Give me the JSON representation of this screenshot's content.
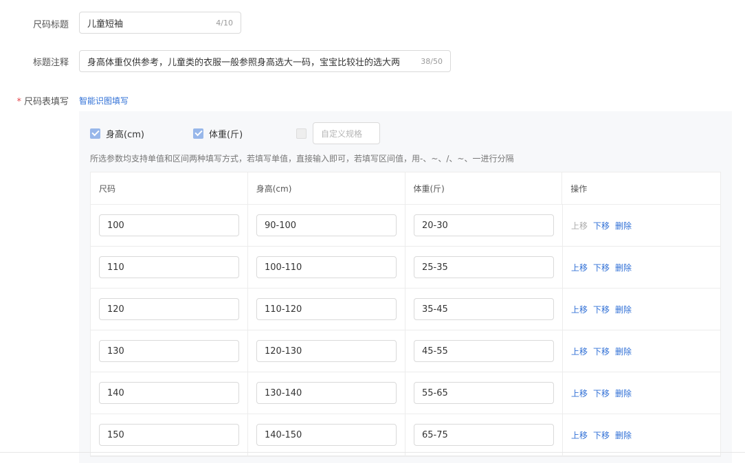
{
  "form": {
    "size_title": {
      "label": "尺码标题",
      "value": "儿童短袖",
      "count": "4/10"
    },
    "title_note": {
      "label": "标题注释",
      "value": "身高体重仅供参考，儿童类的衣服一般参照身高选大一码，宝宝比较壮的选大两",
      "count": "38/50"
    },
    "size_table": {
      "required_mark": "*",
      "label": "尺码表填写",
      "smart_fill_link": "智能识图填写"
    }
  },
  "spec_options": [
    {
      "label": "身高(cm)",
      "checked": true
    },
    {
      "label": "体重(斤)",
      "checked": true
    }
  ],
  "custom_spec": {
    "checked": false,
    "placeholder": "自定义规格"
  },
  "hint": "所选参数均支持单值和区间两种填写方式，若填写单值，直接输入即可，若填写区间值，用-、~、/、~、一进行分隔",
  "table": {
    "headers": [
      "尺码",
      "身高(cm)",
      "体重(斤)",
      "操作"
    ],
    "rows": [
      {
        "size": "100",
        "height": "90-100",
        "weight": "20-30"
      },
      {
        "size": "110",
        "height": "100-110",
        "weight": "25-35"
      },
      {
        "size": "120",
        "height": "110-120",
        "weight": "35-45"
      },
      {
        "size": "130",
        "height": "120-130",
        "weight": "45-55"
      },
      {
        "size": "140",
        "height": "130-140",
        "weight": "55-65"
      },
      {
        "size": "150",
        "height": "140-150",
        "weight": "65-75"
      }
    ],
    "ops": {
      "up": "上移",
      "down": "下移",
      "delete": "删除"
    }
  }
}
